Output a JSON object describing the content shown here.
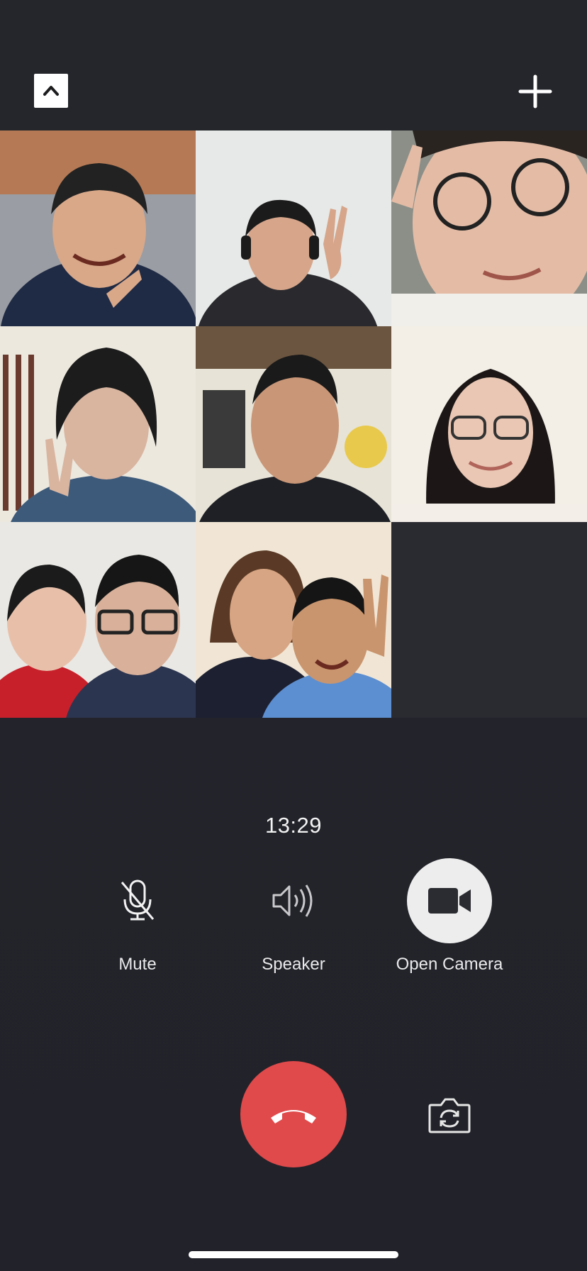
{
  "header": {
    "collapse_icon": "chevron-up-icon",
    "add_icon": "plus-icon"
  },
  "participants": [
    {
      "index": 1,
      "bg": "#b57a55",
      "skin": "#d8a889",
      "shirt": "#1f2a44"
    },
    {
      "index": 2,
      "bg": "#e6e9e7",
      "skin": "#d6a58a",
      "shirt": "#2a2a2e"
    },
    {
      "index": 3,
      "bg": "#8c8f88",
      "skin": "#e4bca6",
      "shirt": "#f0efe9"
    },
    {
      "index": 4,
      "bg": "#ece8de",
      "skin": "#d9b5a0",
      "shirt": "#3d5a7a"
    },
    {
      "index": 5,
      "bg": "#e7e3d6",
      "skin": "#c99677",
      "shirt": "#1e2026"
    },
    {
      "index": 6,
      "bg": "#f3efe6",
      "skin": "#eac7b4",
      "shirt": "#f4eee8"
    },
    {
      "index": 7,
      "bg": "#e9e8e4",
      "skin": "#e8c0aa",
      "shirt": "#c8202b"
    },
    {
      "index": 8,
      "bg": "#f1e6d5",
      "skin": "#d7a583",
      "shirt": "#5c8fd1"
    }
  ],
  "call": {
    "timer": "13:29"
  },
  "controls": {
    "mute_label": "Mute",
    "speaker_label": "Speaker",
    "camera_label": "Open Camera"
  },
  "colors": {
    "background": "#24252c",
    "hangup": "#e04a4b",
    "camera_button": "#ededed"
  }
}
